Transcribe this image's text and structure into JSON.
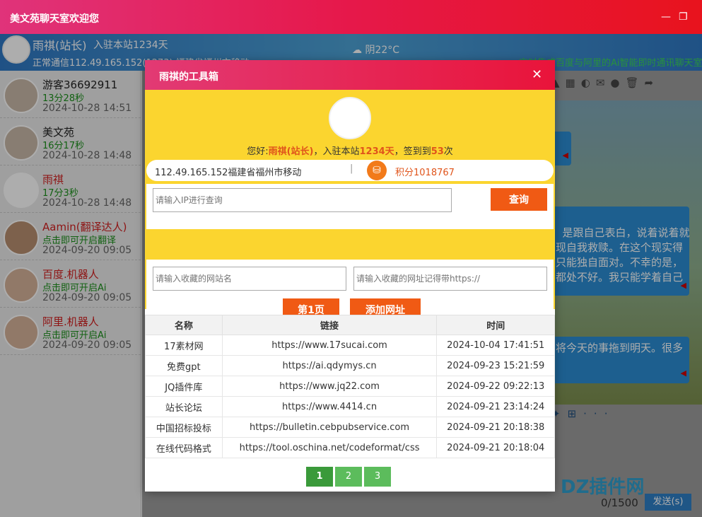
{
  "window": {
    "title": "美文苑聊天室欢迎您",
    "minimize_glyph": "—",
    "maximize_glyph": "❐"
  },
  "header": {
    "name": "雨祺(站长)",
    "join_text": "入驻本站1234天",
    "ip_text": "正常通信112.49.165.152(1273) 福建省福州市移动",
    "weather": "阴22°C",
    "marquee": "实时集成百度与阿里的Ai智能即时通讯聊天室"
  },
  "users": [
    {
      "name": "游客36692911",
      "status": "13分28秒",
      "time": "2024-10-28 14:51",
      "red": false
    },
    {
      "name": "美文苑",
      "status": "16分17秒",
      "time": "2024-10-28 14:48",
      "red": false
    },
    {
      "name": "雨祺",
      "status": "17分3秒",
      "time": "2024-10-28 14:48",
      "red": true
    },
    {
      "name": "Aamin(翻译达人)",
      "status": "点击即可开启翻译",
      "time": "2024-09-20 09:05",
      "red": true
    },
    {
      "name": "百度.机器人",
      "status": "点击即可开启Ai",
      "time": "2024-09-20 09:05",
      "red": true
    },
    {
      "name": "阿里.机器人",
      "status": "点击即可开启Ai",
      "time": "2024-09-20 09:05",
      "red": true
    }
  ],
  "chat": {
    "bubble1": "",
    "bubble2": "是跟自己表白，说着说着就\n现自我救赎。在这个现实得\n只能独自面对。不幸的是，\n都处不好。我只能学着自己",
    "bubble3": "将今天的事拖到明天。很多",
    "counter": "0/1500",
    "send_label": "发送(s)",
    "watermark": "DZ插件网"
  },
  "modal": {
    "title": "雨祺的工具箱",
    "close_glyph": "✕",
    "greeting_prefix": "您好:",
    "greeting_name": "雨祺",
    "greeting_role": "(站长)",
    "greeting_join": "，入驻本站",
    "greeting_days": "1234天",
    "greeting_sign": "，签到到",
    "greeting_sign_count": "53",
    "greeting_suffix": "次",
    "ip_location": "112.49.165.152福建省福州市移动",
    "separator": "|",
    "points": "积分1018767",
    "ip_query_placeholder": "请输入IP进行查询",
    "query_button": "查询",
    "site_name_placeholder": "请输入收藏的网站名",
    "site_url_placeholder": "请输入收藏的网址记得带https://",
    "page1_button": "第1页",
    "add_url_button": "添加网址",
    "table": {
      "headers": [
        "名称",
        "链接",
        "时间"
      ],
      "rows": [
        [
          "17素材网",
          "https://www.17sucai.com",
          "2024-10-04 17:41:51"
        ],
        [
          "免费gpt",
          "https://ai.qdymys.cn",
          "2024-09-23 15:21:59"
        ],
        [
          "JQ插件库",
          "https://www.jq22.com",
          "2024-09-22 09:22:13"
        ],
        [
          "站长论坛",
          "https://www.4414.cn",
          "2024-09-21 23:14:24"
        ],
        [
          "中国招标投标",
          "https://bulletin.cebpubservice.com",
          "2024-09-21 20:18:38"
        ],
        [
          "在线代码格式",
          "https://tool.oschina.net/codeformat/css",
          "2024-09-21 20:18:04"
        ]
      ]
    },
    "pages": [
      "1",
      "2",
      "3"
    ],
    "current_page": "1"
  },
  "colors": {
    "brand_red": "#e9143a",
    "modal_yellow": "#fbd52f",
    "action_orange": "#f05a14",
    "pager_green": "#5cbc5c"
  }
}
